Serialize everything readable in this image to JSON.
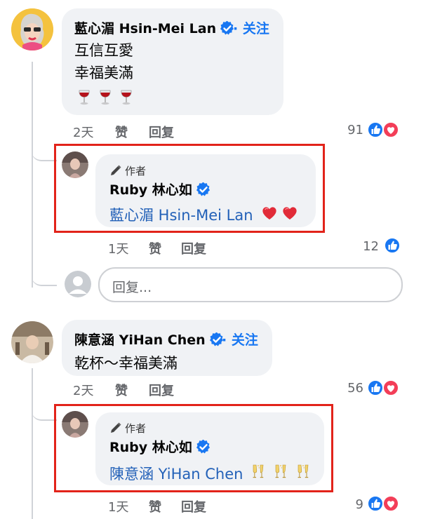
{
  "comments": [
    {
      "author": "藍心湄 Hsin-Mei Lan",
      "follow": "· 关注",
      "lines": [
        "互信互愛",
        "幸福美滿"
      ],
      "emoji_icon": "wine-glass-icon",
      "time": "2天",
      "like_label": "赞",
      "reply_label": "回复",
      "reaction_count": "91",
      "reaction_icons": [
        "like-icon",
        "heart-icon"
      ],
      "reply": {
        "badge": "作者",
        "author": "Ruby 林心如",
        "mention": "藍心湄 Hsin-Mei Lan",
        "emoji_icon": "red-heart-icon",
        "time": "1天",
        "like_label": "赞",
        "reply_label": "回复",
        "reaction_count": "12",
        "reaction_icons": [
          "like-icon"
        ]
      }
    },
    {
      "author": "陳意涵 YiHan Chen",
      "follow": "· 关注",
      "lines": [
        "乾杯～幸福美滿"
      ],
      "time": "2天",
      "like_label": "赞",
      "reply_label": "回复",
      "reaction_count": "56",
      "reaction_icons": [
        "like-icon",
        "heart-icon"
      ],
      "reply": {
        "badge": "作者",
        "author": "Ruby 林心如",
        "mention": "陳意涵 YiHan Chen",
        "emoji_icon": "champagne-glasses-icon",
        "time": "1天",
        "like_label": "赞",
        "reply_label": "回复",
        "reaction_count": "9",
        "reaction_icons": [
          "like-icon",
          "heart-icon"
        ]
      }
    }
  ],
  "reply_box": {
    "placeholder": "回复..."
  },
  "colors": {
    "bubble": "#f0f2f5",
    "link": "#1877f2",
    "mention": "#2361b8",
    "highlight_box": "#e2231a",
    "meta": "#65676b"
  }
}
